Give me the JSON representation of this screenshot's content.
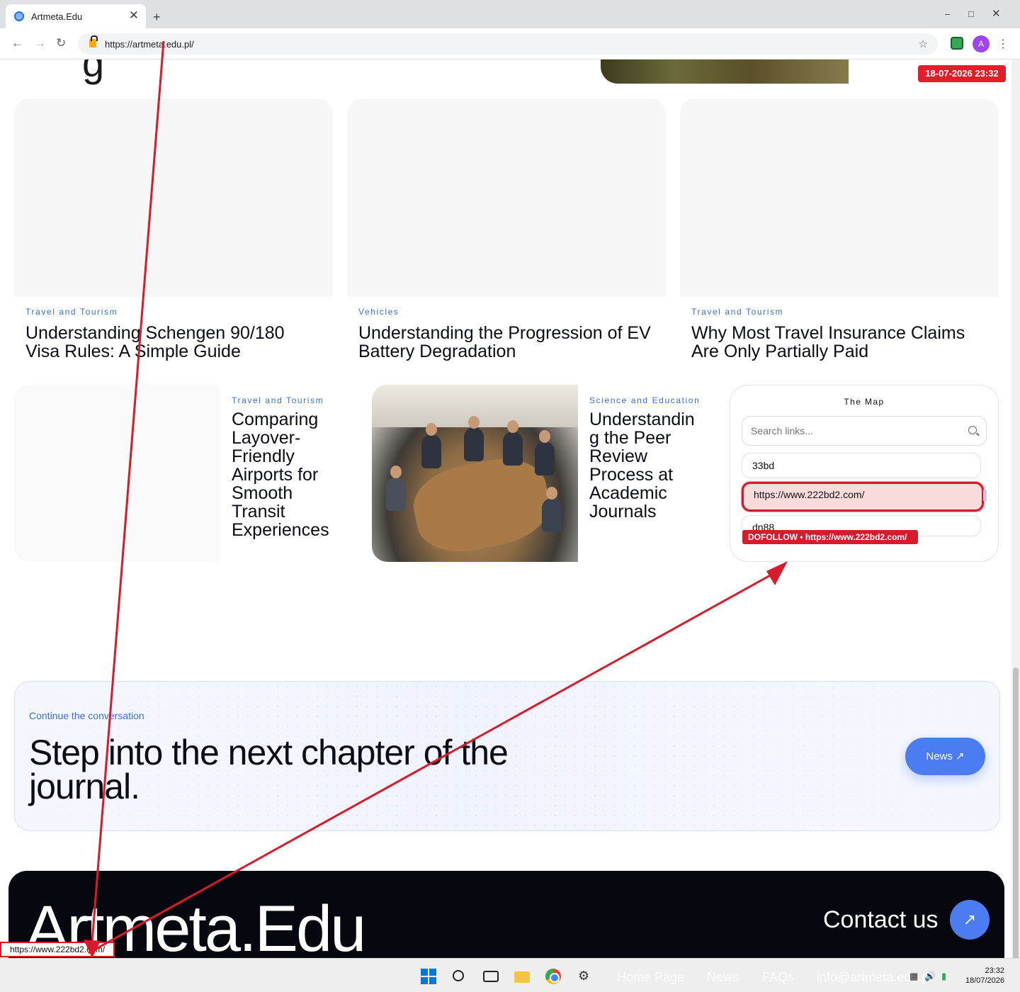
{
  "browser": {
    "tab_title": "Artmeta.Edu",
    "url": "https://artmeta.edu.pl/",
    "avatar_letter": "A",
    "status_url": "https://www.222bd2.com/"
  },
  "overlay": {
    "datetime_badge": "18-07-2026 23:32",
    "dofollow_badge": "DOFOLLOW • https://www.222bd2.com/",
    "accent_color": "#d81b2a"
  },
  "page": {
    "fragment_letter": "g",
    "row1": [
      {
        "category": "Travel and Tourism",
        "title": "Understanding Schengen 90/180 Visa Rules: A Simple Guide"
      },
      {
        "category": "Vehicles",
        "title": "Understanding the Progression of EV Battery Degradation"
      },
      {
        "category": "Travel and Tourism",
        "title": "Why Most Travel Insurance Claims Are Only Partially Paid"
      }
    ],
    "row2": [
      {
        "category": "Travel and Tourism",
        "title": "Comparing Layover-Friendly Airports for Smooth Transit Experiences"
      },
      {
        "category": "Science and Education",
        "title": "Understandin g the Peer Review Process at Academic Journals"
      }
    ],
    "map": {
      "title": "The Map",
      "search_placeholder": "Search links...",
      "links": [
        "33bd",
        "https://www.222bd2.com/",
        "dn88"
      ]
    },
    "cta": {
      "eyebrow": "Continue the conversation",
      "heading": "Step into the next chapter of the journal.",
      "button": "News",
      "button_color": "#4b7cf2"
    },
    "footer": {
      "brand": "Artmeta.Edu",
      "contact": "Contact us"
    }
  },
  "taskbar": {
    "ghost_links": [
      "Home Page",
      "News",
      "FAQs",
      "info@artmeta.edu.pl"
    ],
    "time": "23:32",
    "date": "18/07/2026"
  }
}
